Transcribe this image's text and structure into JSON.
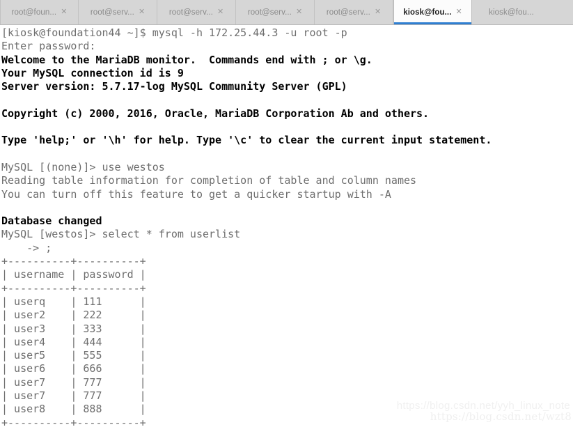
{
  "window": {
    "title": "kiosk@foundation44:~",
    "accent_color": "#2f7fd1",
    "tabbar_bg": "#d6d6d6",
    "terminal_bg": "#ffffff"
  },
  "tabbar": {
    "close_glyph": "✕",
    "tabs": [
      {
        "label": "root@foun...",
        "active": false
      },
      {
        "label": "root@serv...",
        "active": false
      },
      {
        "label": "root@serv...",
        "active": false
      },
      {
        "label": "root@serv...",
        "active": false
      },
      {
        "label": "root@serv...",
        "active": false
      },
      {
        "label": "kiosk@fou...",
        "active": true
      },
      {
        "label": "kiosk@fou...",
        "active": false
      }
    ]
  },
  "terminal": {
    "lines": [
      {
        "text": "[kiosk@foundation44 ~]$ mysql -h 172.25.44.3 -u root -p",
        "bold": false
      },
      {
        "text": "Enter password:",
        "bold": false
      },
      {
        "text": "Welcome to the MariaDB monitor.  Commands end with ; or \\g.",
        "bold": true
      },
      {
        "text": "Your MySQL connection id is 9",
        "bold": true
      },
      {
        "text": "Server version: 5.7.17-log MySQL Community Server (GPL)",
        "bold": true
      },
      {
        "text": "",
        "bold": false
      },
      {
        "text": "Copyright (c) 2000, 2016, Oracle, MariaDB Corporation Ab and others.",
        "bold": true
      },
      {
        "text": "",
        "bold": false
      },
      {
        "text": "Type 'help;' or '\\h' for help. Type '\\c' to clear the current input statement.",
        "bold": true
      },
      {
        "text": "",
        "bold": false
      },
      {
        "text": "MySQL [(none)]> use westos",
        "bold": false
      },
      {
        "text": "Reading table information for completion of table and column names",
        "bold": false
      },
      {
        "text": "You can turn off this feature to get a quicker startup with -A",
        "bold": false
      },
      {
        "text": "",
        "bold": false
      },
      {
        "text": "Database changed",
        "bold": true
      },
      {
        "text": "MySQL [westos]> select * from userlist",
        "bold": false
      },
      {
        "text": "    -> ;",
        "bold": false
      },
      {
        "text": "+----------+----------+",
        "bold": false
      },
      {
        "text": "| username | password |",
        "bold": false
      },
      {
        "text": "+----------+----------+",
        "bold": false
      },
      {
        "text": "| userq    | 111      |",
        "bold": false
      },
      {
        "text": "| user2    | 222      |",
        "bold": false
      },
      {
        "text": "| user3    | 333      |",
        "bold": false
      },
      {
        "text": "| user4    | 444      |",
        "bold": false
      },
      {
        "text": "| user5    | 555      |",
        "bold": false
      },
      {
        "text": "| user6    | 666      |",
        "bold": false
      },
      {
        "text": "| user7    | 777      |",
        "bold": false
      },
      {
        "text": "| user7    | 777      |",
        "bold": false
      },
      {
        "text": "| user8    | 888      |",
        "bold": false
      },
      {
        "text": "+----------+----------+",
        "bold": false
      }
    ],
    "session": {
      "host_prompt": "[kiosk@foundation44 ~]$",
      "command": "mysql -h 172.25.44.3 -u root -p",
      "mysql_host": "172.25.44.3",
      "mysql_user": "root",
      "connection_id": "9",
      "server_version": "5.7.17-log MySQL Community Server (GPL)",
      "database": "westos",
      "table": "userlist"
    },
    "result_table": {
      "columns": [
        "username",
        "password"
      ],
      "rows": [
        [
          "userq",
          "111"
        ],
        [
          "user2",
          "222"
        ],
        [
          "user3",
          "333"
        ],
        [
          "user4",
          "444"
        ],
        [
          "user5",
          "555"
        ],
        [
          "user6",
          "666"
        ],
        [
          "user7",
          "777"
        ],
        [
          "user7",
          "777"
        ],
        [
          "user8",
          "888"
        ]
      ]
    }
  },
  "watermarks": {
    "primary": "https://blog.csdn.net/yyh_linux_note",
    "secondary": "https://blog.csdn.net/wzt8"
  }
}
